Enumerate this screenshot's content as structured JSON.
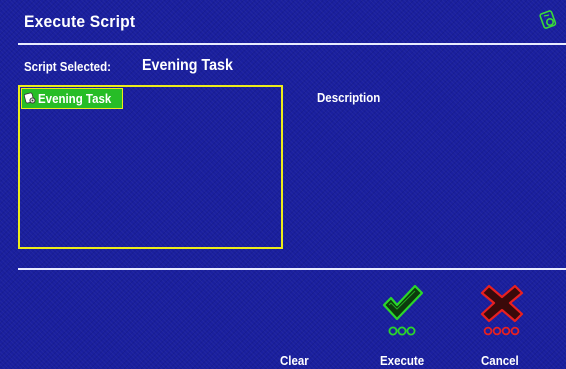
{
  "window": {
    "title": "Execute Script",
    "corner_icon": "script-gear-icon"
  },
  "selection": {
    "label": "Script Selected:",
    "value": "Evening Task"
  },
  "script_list": {
    "items": [
      {
        "label": "Evening Task",
        "icon": "script-gear-icon",
        "selected": true
      }
    ]
  },
  "description": {
    "label": "Description"
  },
  "buttons": {
    "clear": {
      "label": "Clear"
    },
    "execute": {
      "label": "Execute",
      "icon": "green-checkmark-icon"
    },
    "cancel": {
      "label": "Cancel",
      "icon": "red-x-icon"
    }
  },
  "colors": {
    "background": "#1a1f9e",
    "list_border": "#ecec1a",
    "selected_item": "#27bd27",
    "execute_accent": "#2bd62b",
    "cancel_accent": "#e82020",
    "text": "#ffffff"
  }
}
